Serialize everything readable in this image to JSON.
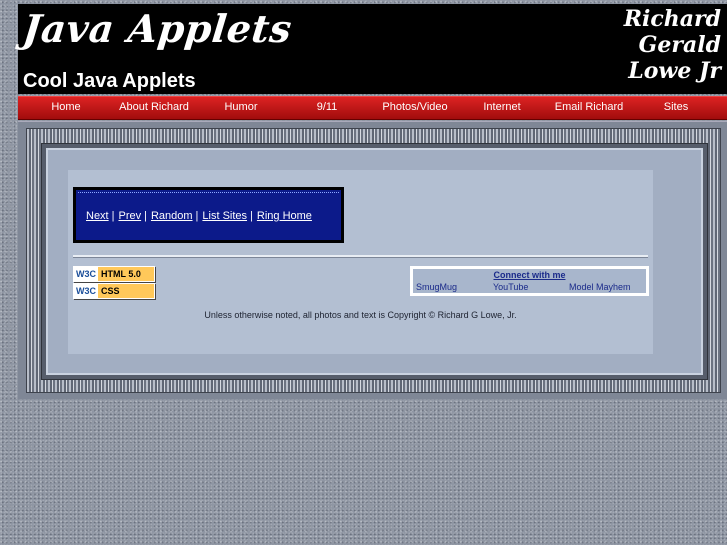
{
  "header": {
    "logo_text": "Java Applets",
    "subtitle": "Cool Java Applets",
    "signature_lines": [
      "Richard",
      "Gerald",
      "Lowe Jr"
    ]
  },
  "nav": {
    "items": [
      "Home",
      "About Richard",
      "Humor",
      "9/11",
      "Photos/Video",
      "Internet",
      "Email Richard",
      "Sites"
    ]
  },
  "webring": {
    "links": [
      "Next",
      "Prev",
      "Random",
      "List Sites",
      "Ring Home"
    ],
    "separator": "|"
  },
  "badges": {
    "w3c_logo": "W3C",
    "html_label": "HTML 5.0",
    "css_label": "CSS"
  },
  "connect": {
    "title": "Connect with me",
    "links": [
      "SmugMug",
      "YouTube",
      "Model Mayhem"
    ]
  },
  "footer": {
    "copyright": "Unless otherwise noted, all photos and text is Copyright © Richard G Lowe, Jr."
  },
  "colors": {
    "nav_bar": "#c01414",
    "webring_box": "#0c1a8a",
    "badge_yellow": "#ffc85a"
  }
}
